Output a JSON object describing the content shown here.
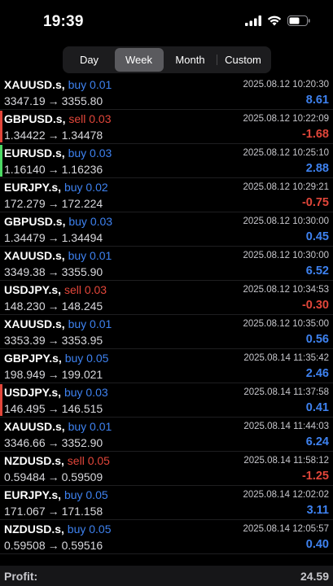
{
  "status_bar": {
    "time": "19:39"
  },
  "period_tabs": {
    "selected": "Week",
    "tabs": [
      {
        "label": "Day"
      },
      {
        "label": "Week"
      },
      {
        "label": "Month"
      },
      {
        "label": "Custom"
      }
    ]
  },
  "colors": {
    "buy": "#3e82f0",
    "sell": "#e2463a",
    "marker_red": "#e2463a",
    "marker_green": "#4cd964"
  },
  "deals": [
    {
      "symbol": "XAUUSD.s,",
      "side": "buy 0.01",
      "type": "buy",
      "open": "3347.19",
      "close": "3355.80",
      "time": "2025.08.12 10:20:30",
      "profit": "8.61",
      "marker": ""
    },
    {
      "symbol": "GBPUSD.s,",
      "side": "sell 0.03",
      "type": "sell",
      "open": "1.34422",
      "close": "1.34478",
      "time": "2025.08.12 10:22:09",
      "profit": "-1.68",
      "marker": "red"
    },
    {
      "symbol": "EURUSD.s,",
      "side": "buy 0.03",
      "type": "buy",
      "open": "1.16140",
      "close": "1.16236",
      "time": "2025.08.12 10:25:10",
      "profit": "2.88",
      "marker": "green"
    },
    {
      "symbol": "EURJPY.s,",
      "side": "buy 0.02",
      "type": "buy",
      "open": "172.279",
      "close": "172.224",
      "time": "2025.08.12 10:29:21",
      "profit": "-0.75",
      "marker": ""
    },
    {
      "symbol": "GBPUSD.s,",
      "side": "buy 0.03",
      "type": "buy",
      "open": "1.34479",
      "close": "1.34494",
      "time": "2025.08.12 10:30:00",
      "profit": "0.45",
      "marker": ""
    },
    {
      "symbol": "XAUUSD.s,",
      "side": "buy 0.01",
      "type": "buy",
      "open": "3349.38",
      "close": "3355.90",
      "time": "2025.08.12 10:30:00",
      "profit": "6.52",
      "marker": ""
    },
    {
      "symbol": "USDJPY.s,",
      "side": "sell 0.03",
      "type": "sell",
      "open": "148.230",
      "close": "148.245",
      "time": "2025.08.12 10:34:53",
      "profit": "-0.30",
      "marker": ""
    },
    {
      "symbol": "XAUUSD.s,",
      "side": "buy 0.01",
      "type": "buy",
      "open": "3353.39",
      "close": "3353.95",
      "time": "2025.08.12 10:35:00",
      "profit": "0.56",
      "marker": ""
    },
    {
      "symbol": "GBPJPY.s,",
      "side": "buy 0.05",
      "type": "buy",
      "open": "198.949",
      "close": "199.021",
      "time": "2025.08.14 11:35:42",
      "profit": "2.46",
      "marker": ""
    },
    {
      "symbol": "USDJPY.s,",
      "side": "buy 0.03",
      "type": "buy",
      "open": "146.495",
      "close": "146.515",
      "time": "2025.08.14 11:37:58",
      "profit": "0.41",
      "marker": "red"
    },
    {
      "symbol": "XAUUSD.s,",
      "side": "buy 0.01",
      "type": "buy",
      "open": "3346.66",
      "close": "3352.90",
      "time": "2025.08.14 11:44:03",
      "profit": "6.24",
      "marker": ""
    },
    {
      "symbol": "NZDUSD.s,",
      "side": "sell 0.05",
      "type": "sell",
      "open": "0.59484",
      "close": "0.59509",
      "time": "2025.08.14 11:58:12",
      "profit": "-1.25",
      "marker": ""
    },
    {
      "symbol": "EURJPY.s,",
      "side": "buy 0.05",
      "type": "buy",
      "open": "171.067",
      "close": "171.158",
      "time": "2025.08.14 12:02:02",
      "profit": "3.11",
      "marker": ""
    },
    {
      "symbol": "NZDUSD.s,",
      "side": "buy 0.05",
      "type": "buy",
      "open": "0.59508",
      "close": "0.59516",
      "time": "2025.08.14 12:05:57",
      "profit": "0.40",
      "marker": ""
    }
  ],
  "arrow": "→",
  "footer": {
    "label": "Profit:",
    "value": "24.59"
  }
}
